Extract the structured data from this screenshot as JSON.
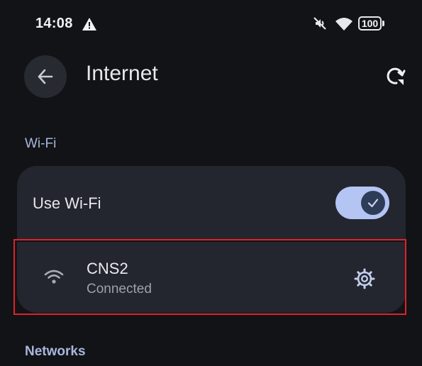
{
  "status_bar": {
    "time": "14:08",
    "battery_level": "100",
    "icons": [
      "alert-icon",
      "mute-icon",
      "wifi-icon",
      "battery-icon"
    ]
  },
  "header": {
    "title": "Internet",
    "back_icon": "arrow-left-icon",
    "refresh_icon": "refresh-icon"
  },
  "wifi_section": {
    "label": "Wi-Fi",
    "use_wifi_label": "Use Wi-Fi",
    "use_wifi_enabled": true,
    "connected_network": {
      "name": "CNS2",
      "status": "Connected",
      "icon": "wifi-signal-icon",
      "settings_icon": "gear-icon"
    }
  },
  "networks_section": {
    "label": "Networks"
  },
  "colors": {
    "background": "#121316",
    "card": "#23262e",
    "accent": "#b4c5f4",
    "section_label": "#a9b6dd",
    "highlight": "#e0212b"
  }
}
